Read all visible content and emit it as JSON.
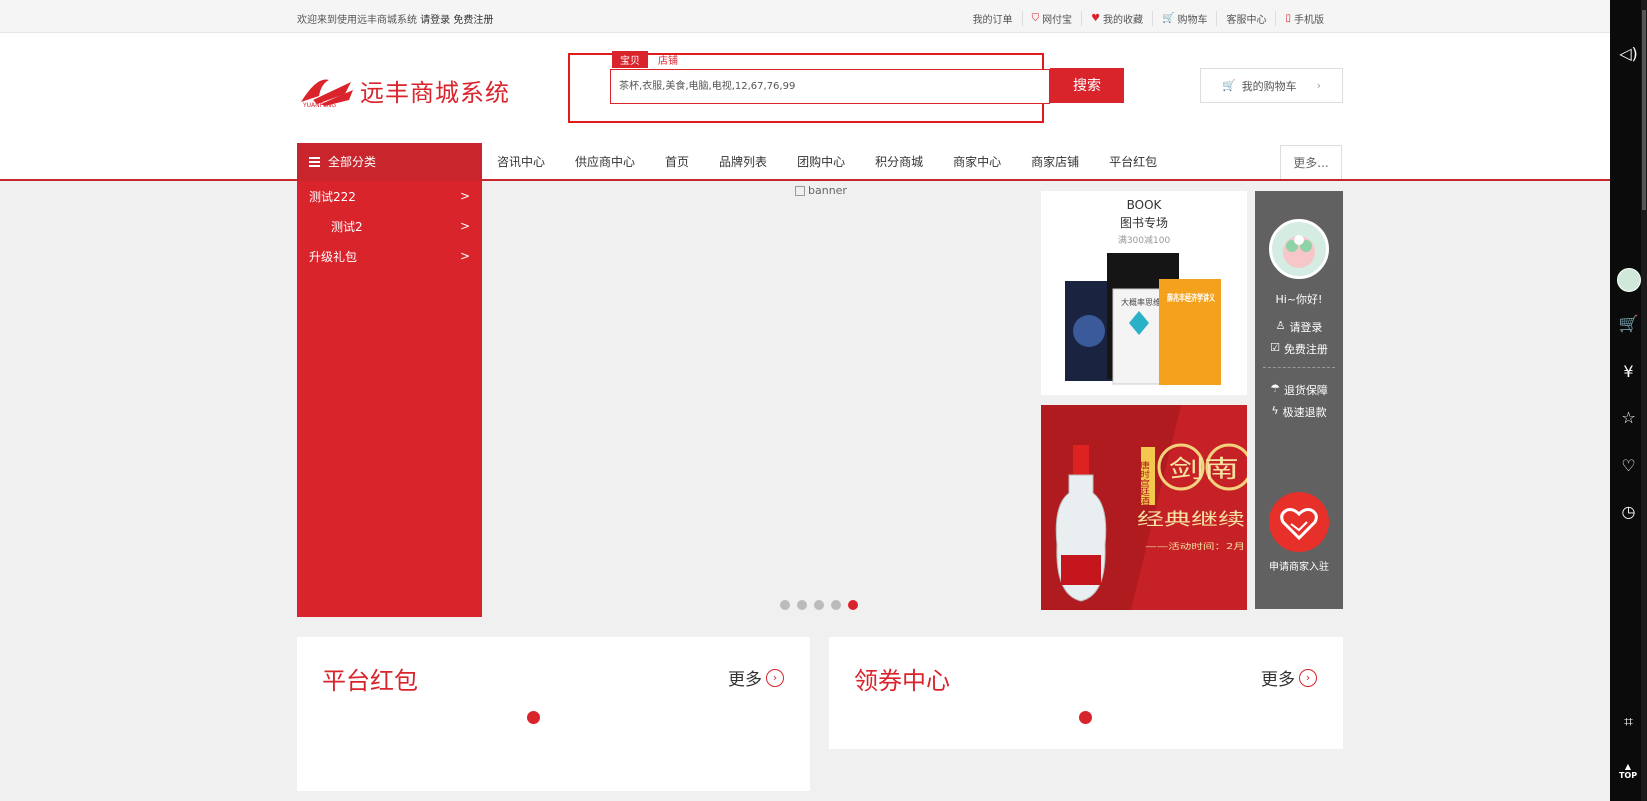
{
  "topbar": {
    "welcome": "欢迎来到使用远丰商城系统",
    "login": "请登录",
    "register": "免费注册",
    "links": [
      "我的订单",
      "网付宝",
      "我的收藏",
      "购物车",
      "客服中心",
      "手机版"
    ]
  },
  "logo": {
    "name": "远丰商城系统",
    "en": "YUANFENG"
  },
  "search": {
    "tab_goods": "宝贝",
    "tab_shop": "店铺",
    "value": "茶杯,衣服,美食,电脑,电视,12,67,76,99",
    "button": "搜索"
  },
  "cart_button": "我的购物车",
  "nav": {
    "all_categories": "全部分类",
    "links": [
      "咨讯中心",
      "供应商中心",
      "首页",
      "品牌列表",
      "团购中心",
      "积分商城",
      "商家中心",
      "商家店铺",
      "平台红包"
    ],
    "more": "更多..."
  },
  "categories": [
    {
      "label": "测试222",
      "arrow": ">"
    },
    {
      "label": "测试2",
      "arrow": ">"
    },
    {
      "label": "升级礼包",
      "arrow": ">"
    }
  ],
  "banner": {
    "alt": "banner",
    "dots": 5,
    "active_dot": 4
  },
  "book_promo": {
    "en": "BOOK",
    "title": "图书专场",
    "sub": "满300减100",
    "book_title": "薛兆丰经济学讲义",
    "book_tag": "大概率思维"
  },
  "liquor_promo": {
    "brand": "剑南",
    "slogan": "经典继续",
    "time": "——活动时间：2月",
    "side": "唐时宫廷酒"
  },
  "user_panel": {
    "greeting": "Hi~你好!",
    "login": "请登录",
    "register": "免费注册",
    "return": "退货保障",
    "refund": "极速退款",
    "apply": "申请商家入驻"
  },
  "cards": [
    {
      "title": "平台红包",
      "more": "更多"
    },
    {
      "title": "领券中心",
      "more": "更多"
    }
  ],
  "sidebar_icons": [
    "speaker-icon",
    "avatar",
    "cart-icon",
    "yen-icon",
    "star-icon",
    "heart-icon",
    "history-icon",
    "qrcode-icon",
    "top-icon"
  ],
  "top_label": "TOP",
  "colors": {
    "brand": "#d9242c",
    "panel": "#616161"
  }
}
